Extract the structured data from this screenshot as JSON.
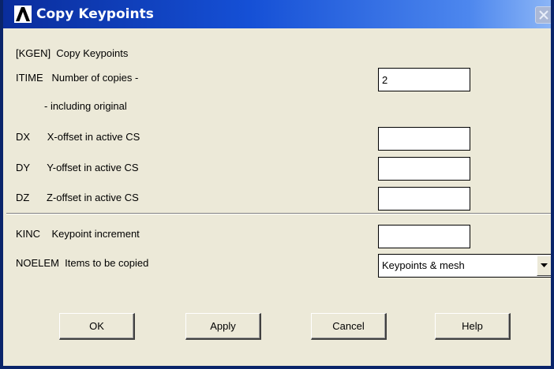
{
  "window": {
    "title": "Copy Keypoints",
    "app_icon": "ansys-logo-icon",
    "close_icon": "close-icon"
  },
  "form": {
    "header": "[KGEN]  Copy Keypoints",
    "itime": {
      "label": "ITIME   Number of copies -",
      "value": "2"
    },
    "itime_note": "- including original",
    "dx": {
      "label": "DX      X-offset in active CS",
      "value": ""
    },
    "dy": {
      "label": "DY      Y-offset in active CS",
      "value": ""
    },
    "dz": {
      "label": "DZ      Z-offset in active CS",
      "value": ""
    },
    "kinc": {
      "label": "KINC    Keypoint increment",
      "value": ""
    },
    "noelem": {
      "label": "NOELEM  Items to be copied",
      "selected": "Keypoints & mesh"
    }
  },
  "buttons": {
    "ok": "OK",
    "apply": "Apply",
    "cancel": "Cancel",
    "help": "Help"
  },
  "colors": {
    "titlebar_start": "#0a2d9c",
    "titlebar_end": "#8bb5f6",
    "dialog_bg": "#ece9d8"
  }
}
